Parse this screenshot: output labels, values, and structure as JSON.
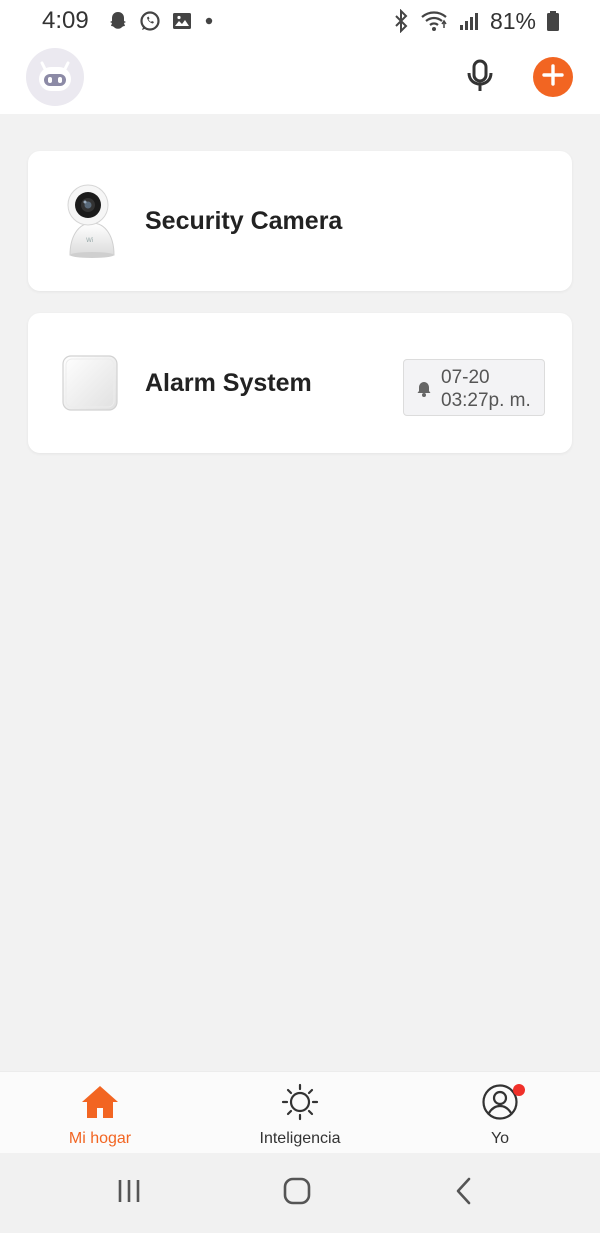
{
  "status_bar": {
    "time": "4:09",
    "battery": "81%",
    "left_icons": [
      "snapchat-icon",
      "whatsapp-icon",
      "gallery-icon",
      "dot-icon"
    ],
    "right_icons": [
      "bluetooth-icon",
      "wifi-icon",
      "signal-icon",
      "battery-icon"
    ]
  },
  "header": {
    "avatar_icon": "robot-avatar-icon",
    "mic_icon": "microphone-icon",
    "add_icon": "plus-icon"
  },
  "devices": [
    {
      "name": "Security Camera",
      "icon": "camera-device-icon"
    },
    {
      "name": "Alarm System",
      "icon": "alarm-hub-icon",
      "alert": {
        "date": "07-20",
        "time": "03:27p. m.",
        "icon": "bell-icon"
      }
    }
  ],
  "tab_bar": {
    "tabs": [
      {
        "label": "Mi hogar",
        "icon": "home-icon",
        "active": true
      },
      {
        "label": "Inteligencia",
        "icon": "sun-icon",
        "active": false
      },
      {
        "label": "Yo",
        "icon": "profile-icon",
        "active": false,
        "badge": true
      }
    ]
  },
  "colors": {
    "accent": "#f26522",
    "background": "#f2f2f2",
    "card": "#ffffff",
    "badge": "#f0302a"
  }
}
